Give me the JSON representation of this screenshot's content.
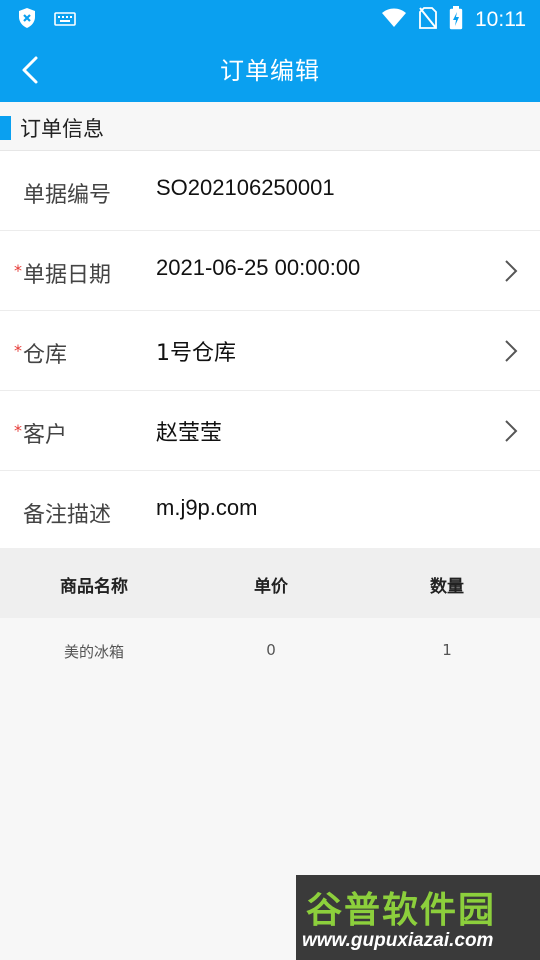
{
  "status_bar": {
    "time": "10:11",
    "icons": [
      "shield-icon",
      "keyboard-icon",
      "wifi-icon",
      "no-sim-icon",
      "battery-charging-icon"
    ]
  },
  "app_bar": {
    "title": "订单编辑",
    "back_icon": "chevron-left-icon"
  },
  "section": {
    "title": "订单信息",
    "accent_color": "#0aa0f0"
  },
  "form": {
    "rows": [
      {
        "label": "单据编号",
        "value": "SO202106250001",
        "required": false,
        "navigable": false
      },
      {
        "label": "单据日期",
        "value": "2021-06-25 00:00:00",
        "required": true,
        "navigable": true
      },
      {
        "label": "仓库",
        "value": "1号仓库",
        "required": true,
        "navigable": true
      },
      {
        "label": "客户",
        "value": "赵莹莹",
        "required": true,
        "navigable": true
      },
      {
        "label": "备注描述",
        "value": "m.j9p.com",
        "required": false,
        "navigable": false
      }
    ],
    "required_mark": "*"
  },
  "table": {
    "headers": [
      "商品名称",
      "单价",
      "数量"
    ],
    "rows": [
      [
        "美的冰箱",
        "0",
        "1"
      ]
    ]
  },
  "watermark": {
    "line1": "谷普软件园",
    "line2": "www.gupuxiazai.com"
  },
  "colors": {
    "primary": "#0aa0f0",
    "required": "#e53935",
    "watermark_green": "#8ccf3c"
  }
}
